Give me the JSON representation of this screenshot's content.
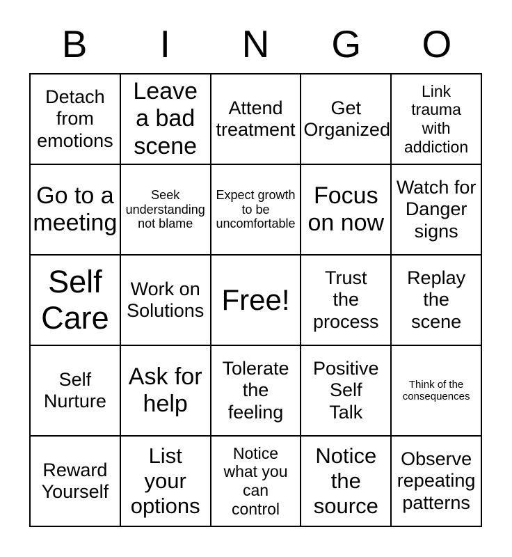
{
  "card": {
    "title": "BINGO",
    "header_letters": [
      "B",
      "I",
      "N",
      "G",
      "O"
    ],
    "free_space_label": "Free!",
    "colors": {
      "background": "#ffffff",
      "text": "#000000",
      "border": "#000000"
    },
    "grid": {
      "rows": 5,
      "columns": 5
    },
    "cells": [
      {
        "text": "Detach\nfrom\nemotions",
        "size": "fs-lg"
      },
      {
        "text": "Leave\na bad\nscene",
        "size": "fs-xxl"
      },
      {
        "text": "Attend\ntreatment",
        "size": "fs-lg"
      },
      {
        "text": "Get\nOrganized",
        "size": "fs-lg"
      },
      {
        "text": "Link\ntrauma\nwith\naddiction",
        "size": "fs-md"
      },
      {
        "text": "Go to a\nmeeting",
        "size": "fs-xxl"
      },
      {
        "text": "Seek\nunderstanding\nnot blame",
        "size": "fs-sm"
      },
      {
        "text": "Expect growth\nto be\nuncomfortable",
        "size": "fs-sm"
      },
      {
        "text": "Focus\non now",
        "size": "fs-xxl"
      },
      {
        "text": "Watch for\nDanger\nsigns",
        "size": "fs-lg"
      },
      {
        "text": "Self\nCare",
        "size": "fs-huge"
      },
      {
        "text": "Work on\nSolutions",
        "size": "fs-lg"
      },
      {
        "text": "Free!",
        "size": "fs-free"
      },
      {
        "text": "Trust\nthe\nprocess",
        "size": "fs-lg"
      },
      {
        "text": "Replay\nthe\nscene",
        "size": "fs-lg"
      },
      {
        "text": "Self\nNurture",
        "size": "fs-lg"
      },
      {
        "text": "Ask for\nhelp",
        "size": "fs-xxl"
      },
      {
        "text": "Tolerate\nthe\nfeeling",
        "size": "fs-lg"
      },
      {
        "text": "Positive\nSelf\nTalk",
        "size": "fs-lg"
      },
      {
        "text": "Think of the\nconsequences",
        "size": "fs-xs"
      },
      {
        "text": "Reward\nYourself",
        "size": "fs-lg"
      },
      {
        "text": "List\nyour\noptions",
        "size": "fs-xl"
      },
      {
        "text": "Notice\nwhat you\ncan\ncontrol",
        "size": "fs-md"
      },
      {
        "text": "Notice\nthe\nsource",
        "size": "fs-xl"
      },
      {
        "text": "Observe\nrepeating\npatterns",
        "size": "fs-lg"
      }
    ]
  }
}
